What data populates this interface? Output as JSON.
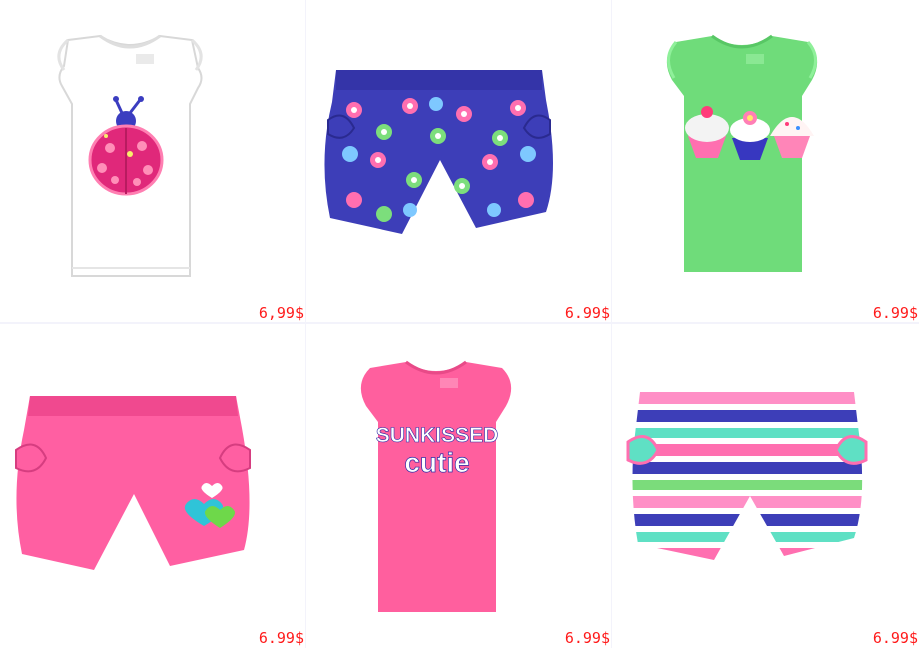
{
  "products": [
    {
      "name": "Ladybug glitter tee",
      "price": "6,99$",
      "icon": "ladybug-tee",
      "color": "#ffffff"
    },
    {
      "name": "Flower print shorts",
      "price": "6.99$",
      "icon": "flower-shorts",
      "color": "#3d3eb8"
    },
    {
      "name": "Cupcake tee",
      "price": "6.99$",
      "icon": "cupcake-tee",
      "color": "#6fdc7a"
    },
    {
      "name": "Pink heart shorts",
      "price": "6.99$",
      "icon": "heart-shorts",
      "color": "#ff5fa2"
    },
    {
      "name": "Sunkissed Cutie tee",
      "price": "6.99$",
      "icon": "sunkissed-tee",
      "color": "#ff5f9e",
      "graphic_line1": "SUNKISSED",
      "graphic_line2": "cutie"
    },
    {
      "name": "Striped shorts",
      "price": "6.99$",
      "icon": "striped-shorts",
      "color": "#3d3eb8"
    }
  ]
}
